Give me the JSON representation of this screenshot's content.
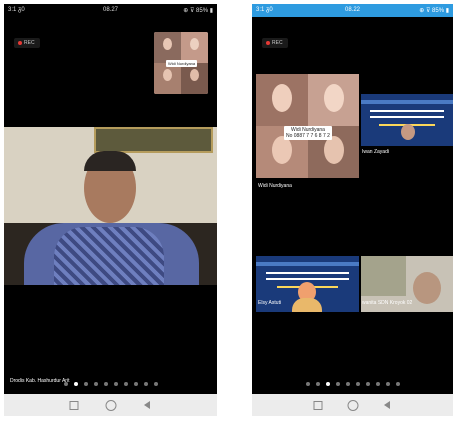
{
  "left_screen": {
    "status": {
      "carrier": "3:1 ᵹ0",
      "time": "08.27",
      "icons": "⊕ ⊽ 85% ▮"
    },
    "rec_label": "REC",
    "pip_name": "Widi Nurdiyana",
    "speaker_label": "Drodis Kab. Hashurdur Arit",
    "page_dots": 10,
    "active_dot": 1
  },
  "right_screen": {
    "status": {
      "carrier": "3:1 ᵹ0",
      "time": "08.22",
      "icons": "⊕ ⊽ 85% ▮"
    },
    "rec_label": "REC",
    "tiles": [
      {
        "label": "Widi Nurdiyana",
        "inner_name": "Widi Nurdiyana",
        "inner_phone": "No 0887 7 7 6 8 7 2"
      },
      {
        "label": "Iwan Zayadi"
      },
      {
        "label": "Elsy Astuti"
      },
      {
        "label": "wanita SDN Kroyok 02"
      }
    ],
    "page_dots": 10,
    "active_dot": 2
  },
  "colors": {
    "status_bar_right": "#2e9be0",
    "rec_dot": "#e53935",
    "slide_blue": "#1a3a7a"
  }
}
